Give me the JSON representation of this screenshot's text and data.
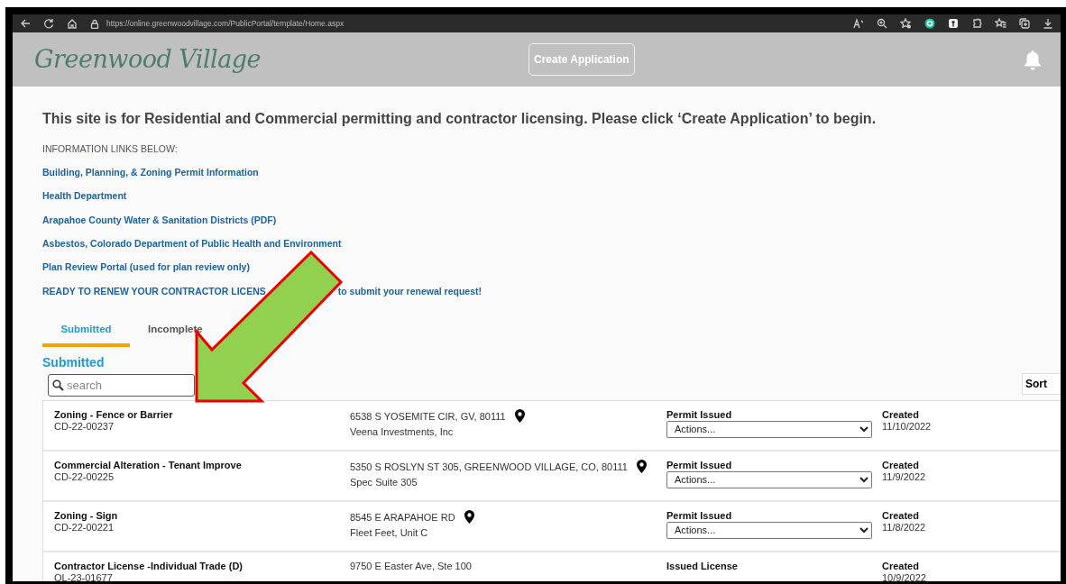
{
  "browser": {
    "url": "https://online.greenwoodvillage.com/PublicPortal/template/Home.aspx"
  },
  "header": {
    "logo": "Greenwood Village",
    "create_button": "Create Application"
  },
  "intro": "This site is for Residential and Commercial permitting and contractor licensing. Please click ‘Create Application’ to begin.",
  "links_heading": "INFORMATION LINKS BELOW:",
  "links": [
    {
      "text": "Building, Planning, & Zoning Permit Information"
    },
    {
      "text": "Health Department"
    },
    {
      "text": "Arapahoe County Water & Sanitation Districts (PDF)"
    },
    {
      "text": "Asbestos, Colorado Department of Public Health and Environment"
    },
    {
      "text": "Plan Review Portal (used for plan review only)"
    },
    {
      "text": "READY TO RENEW YOUR CONTRACTOR LICENS",
      "text_after": "to submit your renewal request!"
    }
  ],
  "tabs": [
    {
      "label": "Submitted",
      "selected": true
    },
    {
      "label": "Incomplete",
      "selected": false
    }
  ],
  "section_title": "Submitted",
  "search": {
    "placeholder": "search"
  },
  "sort_button": "Sort",
  "records": [
    {
      "title": "Zoning - Fence or Barrier",
      "number": "CD-22-00237",
      "address": "6538 S YOSEMITE CIR, GV, 80111",
      "map_pin": true,
      "detail": "Veena Investments, Inc",
      "status": "Permit Issued",
      "action": "Actions...",
      "created_label": "Created",
      "created": "11/10/2022"
    },
    {
      "title": "Commercial Alteration - Tenant Improve",
      "number": "CD-22-00225",
      "address": "5350 S ROSLYN ST 305, GREENWOOD VILLAGE, CO, 80111",
      "map_pin": true,
      "detail": "Spec Suite 305",
      "status": "Permit Issued",
      "action": "Actions...",
      "created_label": "Created",
      "created": "11/9/2022"
    },
    {
      "title": "Zoning - Sign",
      "number": "CD-22-00221",
      "address": "8545 E ARAPAHOE RD",
      "map_pin": true,
      "detail": "Fleet Feet, Unit C",
      "status": "Permit Issued",
      "action": "Actions...",
      "created_label": "Created",
      "created": "11/8/2022"
    },
    {
      "title": "Contractor License -Individual Trade (D)",
      "number": "OL-23-01677",
      "address": "9750 E Easter Ave, Ste 100",
      "map_pin": false,
      "status": "Issued License",
      "created_label": "Created",
      "created": "10/9/2022"
    }
  ]
}
